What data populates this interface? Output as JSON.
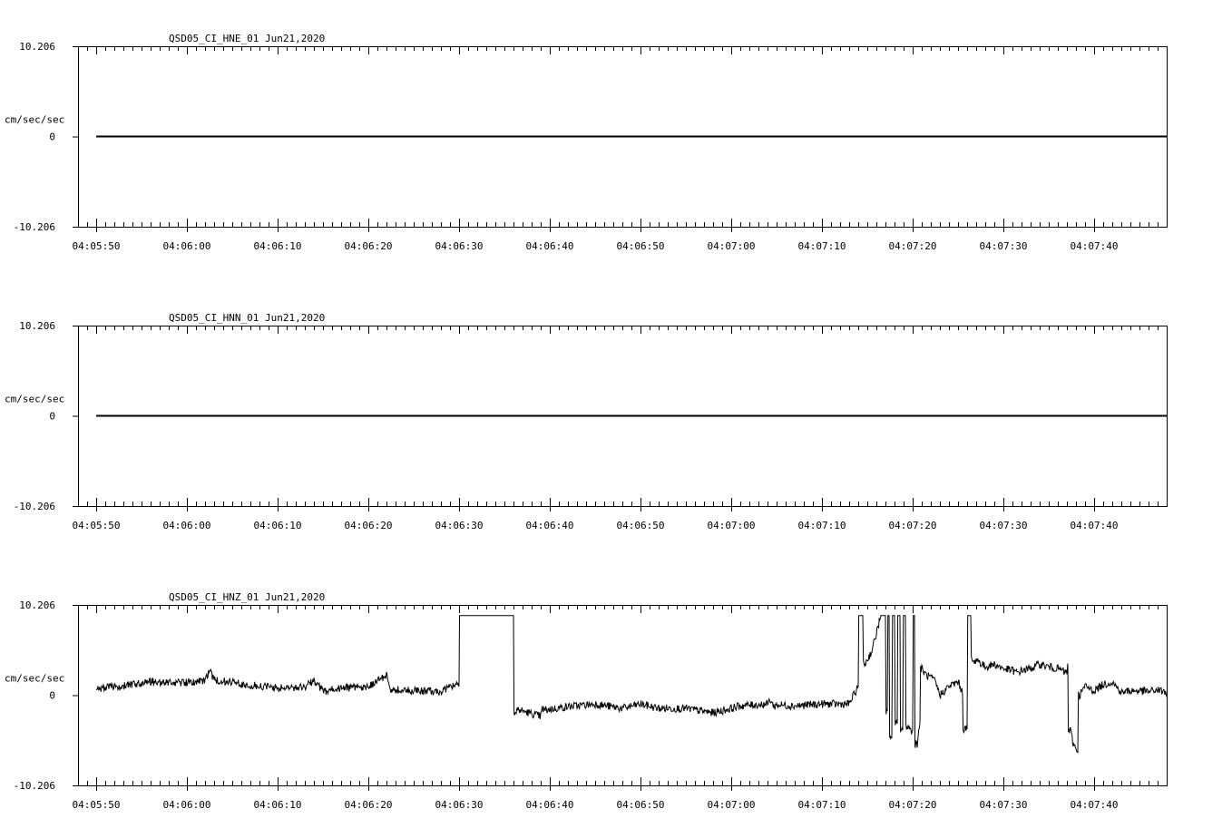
{
  "chart_data": [
    {
      "type": "line",
      "title": "QSD05_CI_HNE_01  Jun21,2020",
      "ylabel": "cm/sec/sec",
      "ylim": [
        -10.206,
        10.206
      ],
      "ytick_labels": [
        "10.206",
        "0",
        "-10.206"
      ],
      "xlim_seconds": [
        -2,
        118
      ],
      "x_tick_labels": [
        "04:05:50",
        "04:06:00",
        "04:06:10",
        "04:06:20",
        "04:06:30",
        "04:06:40",
        "04:06:50",
        "04:07:00",
        "04:07:10",
        "04:07:20",
        "04:07:30",
        "04:07:40"
      ],
      "x_tick_times": [
        0,
        10,
        20,
        30,
        40,
        50,
        60,
        70,
        80,
        90,
        100,
        110
      ],
      "grid": false,
      "series": [
        {
          "t": [
            0,
            118
          ],
          "y": [
            0,
            0
          ]
        }
      ]
    },
    {
      "type": "line",
      "title": "QSD05_CI_HNN_01  Jun21,2020",
      "ylabel": "cm/sec/sec",
      "ylim": [
        -10.206,
        10.206
      ],
      "ytick_labels": [
        "10.206",
        "0",
        "-10.206"
      ],
      "xlim_seconds": [
        -2,
        118
      ],
      "x_tick_labels": [
        "04:05:50",
        "04:06:00",
        "04:06:10",
        "04:06:20",
        "04:06:30",
        "04:06:40",
        "04:06:50",
        "04:07:00",
        "04:07:10",
        "04:07:20",
        "04:07:30",
        "04:07:40"
      ],
      "x_tick_times": [
        0,
        10,
        20,
        30,
        40,
        50,
        60,
        70,
        80,
        90,
        100,
        110
      ],
      "grid": false,
      "series": [
        {
          "t": [
            0,
            118
          ],
          "y": [
            0,
            0
          ]
        }
      ]
    },
    {
      "type": "line",
      "title": "QSD05_CI_HNZ_01  Jun21,2020",
      "ylabel": "cm/sec/sec",
      "ylim": [
        -10.206,
        10.206
      ],
      "ytick_labels": [
        "10.206",
        "0",
        "-10.206"
      ],
      "xlim_seconds": [
        -2,
        118
      ],
      "x_tick_labels": [
        "04:05:50",
        "04:06:00",
        "04:06:10",
        "04:06:20",
        "04:06:30",
        "04:06:40",
        "04:06:50",
        "04:07:00",
        "04:07:10",
        "04:07:20",
        "04:07:30",
        "04:07:40"
      ],
      "x_tick_times": [
        0,
        10,
        20,
        30,
        40,
        50,
        60,
        70,
        80,
        90,
        100,
        110
      ],
      "grid": false,
      "series": [
        {
          "t": [
            0,
            3,
            6,
            9,
            12,
            12.5,
            13,
            15,
            18,
            20,
            23,
            24,
            25,
            27,
            30,
            32,
            32.5,
            33,
            35,
            38,
            40,
            40.1,
            42,
            44,
            44.5,
            45,
            46,
            46.3,
            46.4,
            49,
            49.1,
            49.2,
            49.3,
            52,
            55,
            58,
            60,
            62,
            65,
            68,
            70,
            71,
            74,
            74.3,
            74.7,
            75,
            77,
            80,
            83,
            84,
            84.3,
            84.5,
            84.7,
            85,
            85.5,
            86,
            86.5,
            86.7,
            87,
            87.2,
            87.4,
            87.7,
            88,
            88.3,
            88.6,
            88.9,
            89.2,
            89.5,
            89.8,
            90,
            90.2,
            90.5,
            90.8,
            91,
            91.3,
            91.6,
            92,
            92.5,
            93,
            94,
            95,
            95.5,
            96,
            96.2,
            96.4,
            96.6,
            96.8,
            97,
            97.3,
            97.6,
            98,
            99,
            100,
            101,
            101.5,
            102,
            103,
            104,
            105,
            106,
            107,
            107.1,
            107.4,
            107.7,
            108,
            108.2,
            108.4,
            109,
            110,
            111,
            112,
            113,
            114,
            115,
            116,
            117,
            118
          ],
          "y": [
            0.8,
            1.0,
            1.5,
            1.4,
            1.6,
            2.8,
            1.7,
            1.4,
            1.0,
            0.8,
            0.9,
            1.7,
            0.4,
            0.8,
            0.9,
            2.3,
            0.3,
            0.6,
            0.5,
            0.4,
            1.5,
            9.0,
            9.0,
            9.0,
            9.0,
            9.0,
            9.0,
            -2.0,
            -1.6,
            -2.4,
            -1.8,
            -1.5,
            -1.7,
            -1.3,
            -1.0,
            -1.5,
            -1.0,
            -1.5,
            -1.5,
            -2.0,
            -1.5,
            -1.2,
            -1.0,
            -0.5,
            -1.3,
            -1.1,
            -1.2,
            -1.0,
            -1.0,
            1.0,
            9.0,
            9.0,
            3.5,
            4.0,
            5.0,
            7.0,
            9.0,
            9.0,
            9.0,
            -2.0,
            9.0,
            -5.0,
            9.0,
            -3.0,
            9.0,
            -4.0,
            9.0,
            -3.5,
            -4.0,
            -4.0,
            9.0,
            -5.5,
            -3.0,
            3.0,
            2.5,
            2.2,
            2.0,
            1.5,
            0.0,
            1.0,
            1.5,
            0.3,
            -3.8,
            9.0,
            9.0,
            4.0,
            3.5,
            4.2,
            3.8,
            3.5,
            3.2,
            3.5,
            3.0,
            2.8,
            2.5,
            2.8,
            3.0,
            3.5,
            3.2,
            3.0,
            2.5,
            3.5,
            -4.0,
            -5.5,
            -6.0,
            -6.2,
            0.0,
            1.0,
            0.5,
            1.2,
            1.5,
            0.3,
            0.5,
            0.5,
            0.4,
            0.6,
            0.3,
            0.5,
            0.4,
            -0.2
          ]
        }
      ]
    }
  ]
}
